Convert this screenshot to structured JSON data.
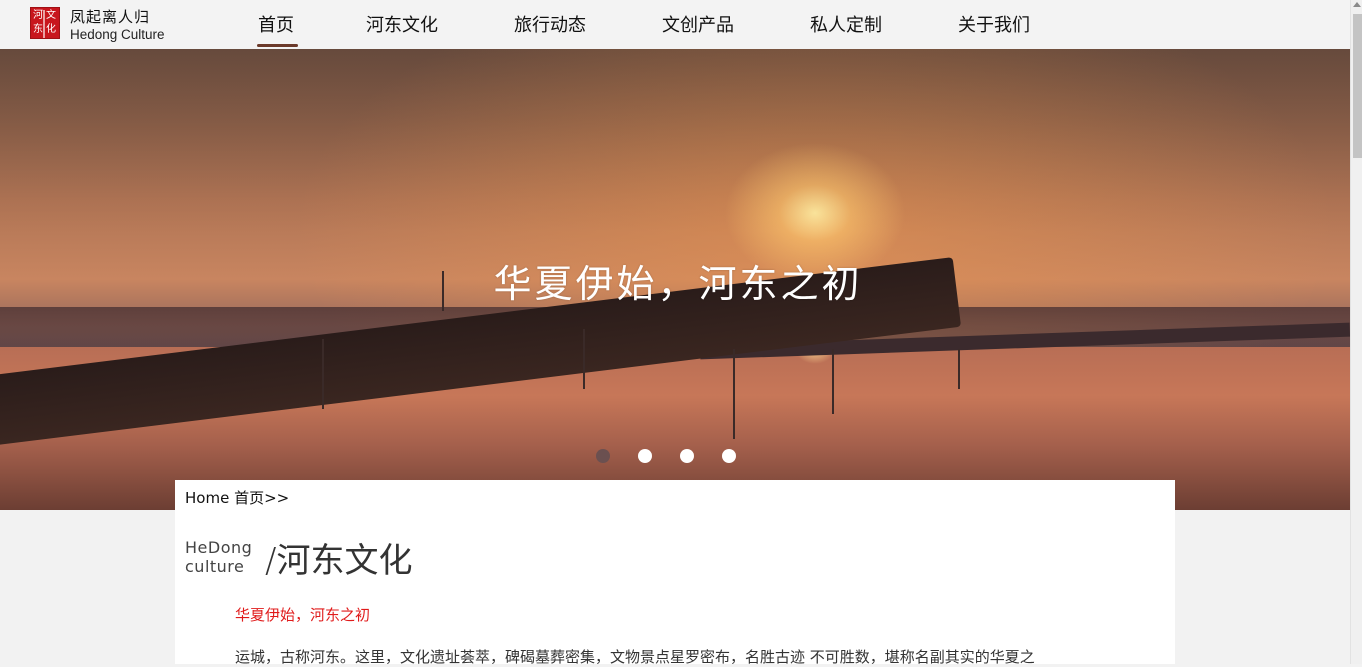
{
  "brand": {
    "logo_glyphs": [
      "河",
      "文",
      "东",
      "化"
    ],
    "name_cn": "凤起离人归",
    "name_en": "Hedong Culture",
    "logo_color": "#c8161d"
  },
  "nav": {
    "items": [
      {
        "label": "首页",
        "active": true
      },
      {
        "label": "河东文化",
        "active": false
      },
      {
        "label": "旅行动态",
        "active": false
      },
      {
        "label": "文创产品",
        "active": false
      },
      {
        "label": "私人定制",
        "active": false
      },
      {
        "label": "关于我们",
        "active": false
      }
    ],
    "active_underline_color": "#6b3a2a"
  },
  "banner": {
    "caption": "华夏伊始，河东之初",
    "slide_count": 4,
    "active_slide": 1
  },
  "content": {
    "breadcrumb": "Home 首页>>",
    "section_title_en_line1": "HeDong",
    "section_title_en_line2": "culture",
    "section_title_cn": "/河东文化",
    "subtitle": "华夏伊始，河东之初",
    "subtitle_color": "#e01b1b",
    "body_text": "运城，古称河东。这里，文化遗址荟萃，碑碣墓葬密集，文物景点星罗密布，名胜古迹 不可胜数，堪称名副其实的华夏之"
  }
}
